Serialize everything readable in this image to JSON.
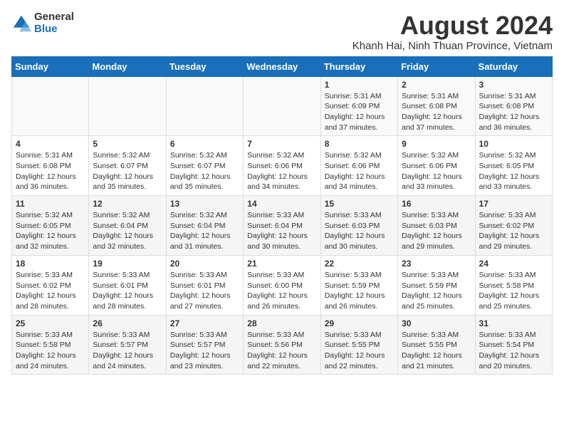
{
  "logo": {
    "general": "General",
    "blue": "Blue"
  },
  "title": "August 2024",
  "subtitle": "Khanh Hai, Ninh Thuan Province, Vietnam",
  "weekdays": [
    "Sunday",
    "Monday",
    "Tuesday",
    "Wednesday",
    "Thursday",
    "Friday",
    "Saturday"
  ],
  "weeks": [
    [
      {
        "day": "",
        "info": ""
      },
      {
        "day": "",
        "info": ""
      },
      {
        "day": "",
        "info": ""
      },
      {
        "day": "",
        "info": ""
      },
      {
        "day": "1",
        "info": "Sunrise: 5:31 AM\nSunset: 6:09 PM\nDaylight: 12 hours\nand 37 minutes."
      },
      {
        "day": "2",
        "info": "Sunrise: 5:31 AM\nSunset: 6:08 PM\nDaylight: 12 hours\nand 37 minutes."
      },
      {
        "day": "3",
        "info": "Sunrise: 5:31 AM\nSunset: 6:08 PM\nDaylight: 12 hours\nand 36 minutes."
      }
    ],
    [
      {
        "day": "4",
        "info": "Sunrise: 5:31 AM\nSunset: 6:08 PM\nDaylight: 12 hours\nand 36 minutes."
      },
      {
        "day": "5",
        "info": "Sunrise: 5:32 AM\nSunset: 6:07 PM\nDaylight: 12 hours\nand 35 minutes."
      },
      {
        "day": "6",
        "info": "Sunrise: 5:32 AM\nSunset: 6:07 PM\nDaylight: 12 hours\nand 35 minutes."
      },
      {
        "day": "7",
        "info": "Sunrise: 5:32 AM\nSunset: 6:06 PM\nDaylight: 12 hours\nand 34 minutes."
      },
      {
        "day": "8",
        "info": "Sunrise: 5:32 AM\nSunset: 6:06 PM\nDaylight: 12 hours\nand 34 minutes."
      },
      {
        "day": "9",
        "info": "Sunrise: 5:32 AM\nSunset: 6:06 PM\nDaylight: 12 hours\nand 33 minutes."
      },
      {
        "day": "10",
        "info": "Sunrise: 5:32 AM\nSunset: 6:05 PM\nDaylight: 12 hours\nand 33 minutes."
      }
    ],
    [
      {
        "day": "11",
        "info": "Sunrise: 5:32 AM\nSunset: 6:05 PM\nDaylight: 12 hours\nand 32 minutes."
      },
      {
        "day": "12",
        "info": "Sunrise: 5:32 AM\nSunset: 6:04 PM\nDaylight: 12 hours\nand 32 minutes."
      },
      {
        "day": "13",
        "info": "Sunrise: 5:32 AM\nSunset: 6:04 PM\nDaylight: 12 hours\nand 31 minutes."
      },
      {
        "day": "14",
        "info": "Sunrise: 5:33 AM\nSunset: 6:04 PM\nDaylight: 12 hours\nand 30 minutes."
      },
      {
        "day": "15",
        "info": "Sunrise: 5:33 AM\nSunset: 6:03 PM\nDaylight: 12 hours\nand 30 minutes."
      },
      {
        "day": "16",
        "info": "Sunrise: 5:33 AM\nSunset: 6:03 PM\nDaylight: 12 hours\nand 29 minutes."
      },
      {
        "day": "17",
        "info": "Sunrise: 5:33 AM\nSunset: 6:02 PM\nDaylight: 12 hours\nand 29 minutes."
      }
    ],
    [
      {
        "day": "18",
        "info": "Sunrise: 5:33 AM\nSunset: 6:02 PM\nDaylight: 12 hours\nand 28 minutes."
      },
      {
        "day": "19",
        "info": "Sunrise: 5:33 AM\nSunset: 6:01 PM\nDaylight: 12 hours\nand 28 minutes."
      },
      {
        "day": "20",
        "info": "Sunrise: 5:33 AM\nSunset: 6:01 PM\nDaylight: 12 hours\nand 27 minutes."
      },
      {
        "day": "21",
        "info": "Sunrise: 5:33 AM\nSunset: 6:00 PM\nDaylight: 12 hours\nand 26 minutes."
      },
      {
        "day": "22",
        "info": "Sunrise: 5:33 AM\nSunset: 5:59 PM\nDaylight: 12 hours\nand 26 minutes."
      },
      {
        "day": "23",
        "info": "Sunrise: 5:33 AM\nSunset: 5:59 PM\nDaylight: 12 hours\nand 25 minutes."
      },
      {
        "day": "24",
        "info": "Sunrise: 5:33 AM\nSunset: 5:58 PM\nDaylight: 12 hours\nand 25 minutes."
      }
    ],
    [
      {
        "day": "25",
        "info": "Sunrise: 5:33 AM\nSunset: 5:58 PM\nDaylight: 12 hours\nand 24 minutes."
      },
      {
        "day": "26",
        "info": "Sunrise: 5:33 AM\nSunset: 5:57 PM\nDaylight: 12 hours\nand 24 minutes."
      },
      {
        "day": "27",
        "info": "Sunrise: 5:33 AM\nSunset: 5:57 PM\nDaylight: 12 hours\nand 23 minutes."
      },
      {
        "day": "28",
        "info": "Sunrise: 5:33 AM\nSunset: 5:56 PM\nDaylight: 12 hours\nand 22 minutes."
      },
      {
        "day": "29",
        "info": "Sunrise: 5:33 AM\nSunset: 5:55 PM\nDaylight: 12 hours\nand 22 minutes."
      },
      {
        "day": "30",
        "info": "Sunrise: 5:33 AM\nSunset: 5:55 PM\nDaylight: 12 hours\nand 21 minutes."
      },
      {
        "day": "31",
        "info": "Sunrise: 5:33 AM\nSunset: 5:54 PM\nDaylight: 12 hours\nand 20 minutes."
      }
    ]
  ]
}
